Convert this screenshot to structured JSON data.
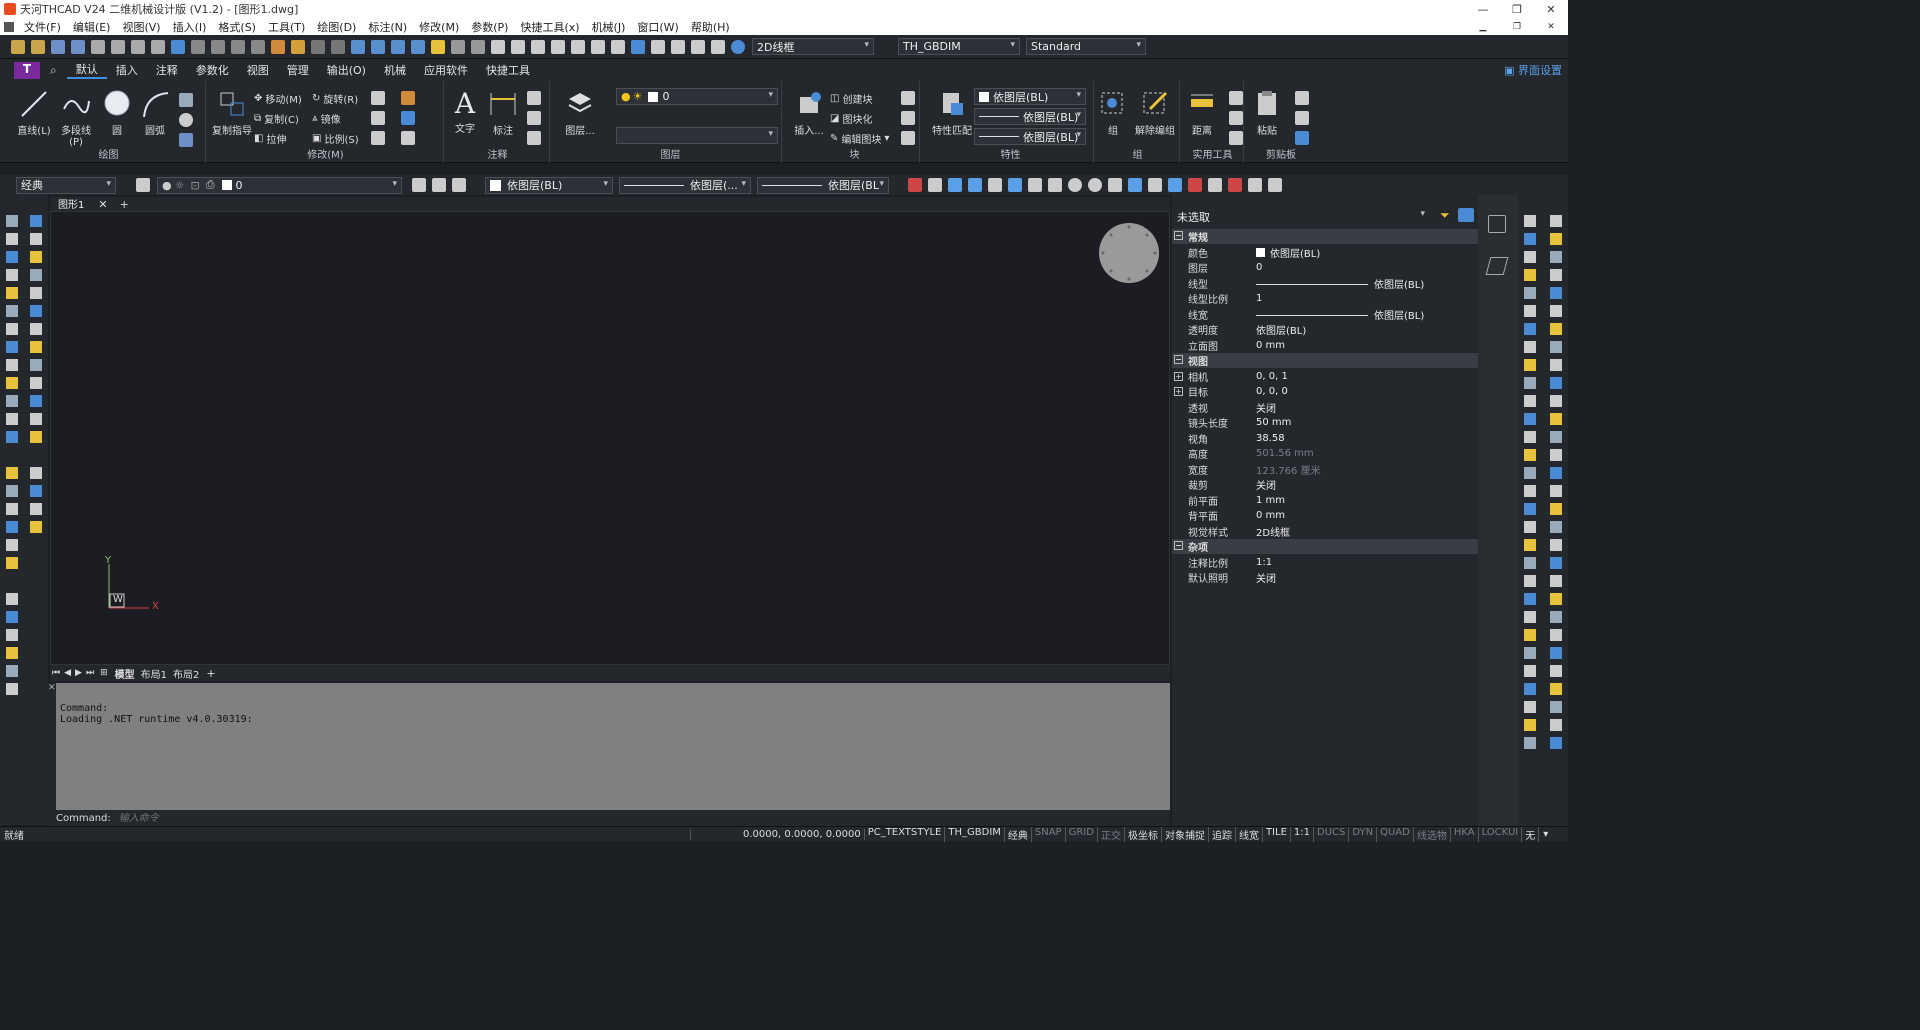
{
  "title": "天河THCAD V24 二维机械设计版 (V1.2) - [图形1.dwg]",
  "menu": [
    "文件(F)",
    "编辑(E)",
    "视图(V)",
    "插入(I)",
    "格式(S)",
    "工具(T)",
    "绘图(D)",
    "标注(N)",
    "修改(M)",
    "参数(P)",
    "快捷工具(x)",
    "机械(J)",
    "窗口(W)",
    "帮助(H)"
  ],
  "qat": {
    "visual_style": "2D线框",
    "dim_style": "TH_GBDIM",
    "text_style": "Standard"
  },
  "ribbon_tabs": [
    "默认",
    "插入",
    "注释",
    "参数化",
    "视图",
    "管理",
    "输出(O)",
    "机械",
    "应用软件",
    "快捷工具"
  ],
  "interface_settings": "界面设置",
  "ribbon": {
    "draw": {
      "line": "直线(L)",
      "polyline": "多段线(P)",
      "circle": "圆",
      "arc": "圆弧",
      "label": "绘图"
    },
    "modify": {
      "copy_guide": "复制指导",
      "move": "移动(M)",
      "rotate": "旋转(R)",
      "copy": "复制(C)",
      "mirror": "镜像",
      "stretch": "拉伸",
      "scale": "比例(S)",
      "label": "修改(M)"
    },
    "annotate": {
      "text": "文字",
      "dim": "标注",
      "label": "注释"
    },
    "layers": {
      "layer": "图层...",
      "current": "0",
      "label": "图层"
    },
    "block": {
      "insert": "插入...",
      "create": "创建块",
      "blockify": "图块化",
      "edit": "编辑图块",
      "label": "块"
    },
    "props": {
      "match": "特性匹配",
      "color": "依图层(BL)",
      "linetype": "依图层(BL)",
      "lineweight": "依图层(BL)",
      "label": "特性"
    },
    "group": {
      "group": "组",
      "ungroup": "解除编组",
      "label": "组"
    },
    "utils": {
      "distance": "距离",
      "label": "实用工具"
    },
    "clipboard": {
      "paste": "粘贴",
      "label": "剪贴板"
    }
  },
  "propbar": {
    "workspace": "经典",
    "layer": "0",
    "color": "依图层(BL)",
    "linetype": "依图层(...",
    "lineweight": "依图层(BL"
  },
  "doc_tab": "图形1",
  "layout_tabs": [
    "模型",
    "布局1",
    "布局2"
  ],
  "ucs": {
    "y": "Y",
    "x": "X",
    "w": "W"
  },
  "command_history": [
    "Command:",
    "Loading .NET runtime v4.0.30319:"
  ],
  "command_prompt": "Command:",
  "command_placeholder": "输入命令",
  "status": {
    "ready": "就绪",
    "coords": "0.0000, 0.0000, 0.0000",
    "items": [
      "PC_TEXTSTYLE",
      "TH_GBDIM",
      "经典",
      "SNAP",
      "GRID",
      "正交",
      "极坐标",
      "对象捕捉",
      "追踪",
      "线宽",
      "TILE",
      "1:1",
      "DUCS",
      "DYN",
      "QUAD",
      "线选物",
      "HKA",
      "LOCKUI",
      "无"
    ]
  },
  "properties": {
    "selection": "未选取",
    "sections": [
      {
        "name": "常规",
        "rows": [
          [
            "颜色",
            "依图层(BL)"
          ],
          [
            "图层",
            "0"
          ],
          [
            "线型",
            "依图层(BL)"
          ],
          [
            "线型比例",
            "1"
          ],
          [
            "线宽",
            "依图层(BL)"
          ],
          [
            "透明度",
            "依图层(BL)"
          ],
          [
            "立面图",
            "0 mm"
          ]
        ]
      },
      {
        "name": "视图",
        "rows": [
          [
            "相机",
            "0, 0, 1"
          ],
          [
            "目标",
            "0, 0, 0"
          ],
          [
            "透视",
            "关闭"
          ],
          [
            "镜头长度",
            "50 mm"
          ],
          [
            "视角",
            "38.58"
          ],
          [
            "高度",
            "501.56 mm"
          ],
          [
            "宽度",
            "123.766 厘米"
          ],
          [
            "裁剪",
            "关闭"
          ],
          [
            "前平面",
            "1 mm"
          ],
          [
            "背平面",
            "0 mm"
          ],
          [
            "视觉样式",
            "2D线框"
          ]
        ]
      },
      {
        "name": "杂项",
        "rows": [
          [
            "注释比例",
            "1:1"
          ],
          [
            "默认照明",
            "关闭"
          ]
        ]
      }
    ]
  }
}
